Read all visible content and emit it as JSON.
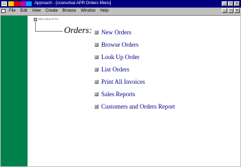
{
  "window": {
    "title": "Approach - [ccwsvrbat APR:Orders Menu]",
    "controls": [
      "_",
      "□",
      "x"
    ],
    "mdi_controls": [
      "_",
      "□",
      "x"
    ]
  },
  "menubar": {
    "items": [
      "File",
      "Edit",
      "View",
      "Create",
      "Browse",
      "Window",
      "Help"
    ]
  },
  "content": {
    "main_menu_link": "Main Menu (F10)",
    "heading": "Orders:",
    "options": [
      "New Orders",
      "Browse Orders",
      "Look Up Order",
      "List Orders",
      "Print All Invoices",
      "Sales Reports",
      "Customers and Orders Report"
    ]
  },
  "colors": {
    "sidebar": "#00804a",
    "title_bar": "#000080",
    "option_text": "#000080"
  }
}
